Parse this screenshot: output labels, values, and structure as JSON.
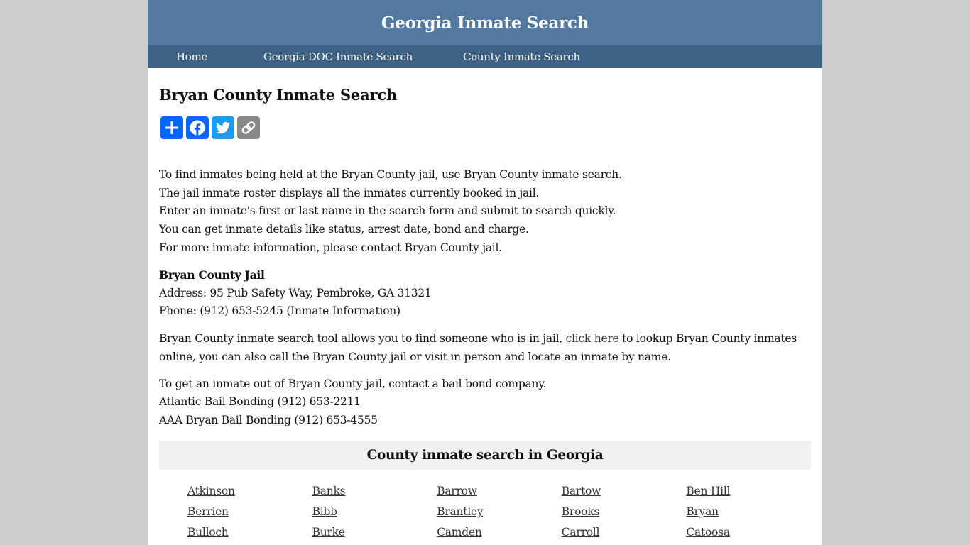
{
  "site": {
    "title": "Georgia Inmate Search"
  },
  "nav": {
    "items": [
      {
        "label": "Home"
      },
      {
        "label": "Georgia DOC Inmate Search"
      },
      {
        "label": "County Inmate Search"
      }
    ]
  },
  "page": {
    "title": "Bryan County Inmate Search"
  },
  "share": {
    "buttons": [
      {
        "icon": "share-plus-icon",
        "label": "Share",
        "color": "#0166ff"
      },
      {
        "icon": "facebook-icon",
        "label": "Facebook",
        "color": "#0866ff"
      },
      {
        "icon": "twitter-icon",
        "label": "Twitter",
        "color": "#1d9bf0"
      },
      {
        "icon": "copy-link-icon",
        "label": "Copy Link",
        "color": "#888888"
      }
    ]
  },
  "intro": {
    "lines": [
      "To find inmates being held at the Bryan County jail, use Bryan County inmate search.",
      "The jail inmate roster displays all the inmates currently booked in jail.",
      "Enter an inmate's first or last name in the search form and submit to search quickly.",
      "You can get inmate details like status, arrest date, bond and charge.",
      "For more inmate information, please contact Bryan County jail."
    ]
  },
  "jail": {
    "name": "Bryan County Jail",
    "address": "Address: 95 Pub Safety Way, Pembroke, GA 31321",
    "phone": "Phone: (912) 653-5245 (Inmate Information)"
  },
  "search_tool": {
    "before_link": "Bryan County inmate search tool allows you to find someone who is in jail, ",
    "link_text": "click here",
    "after_link": " to lookup Bryan County inmates online, you can also call the Bryan County jail or visit in person and locate an inmate by name."
  },
  "bail": {
    "intro": "To get an inmate out of Bryan County jail, contact a bail bond company.",
    "companies": [
      "Atlantic Bail Bonding (912) 653-2211",
      "AAA Bryan Bail Bonding (912) 653-4555"
    ]
  },
  "counties": {
    "heading": "County inmate search in Georgia",
    "items": [
      "Atkinson",
      "Banks",
      "Barrow",
      "Bartow",
      "Ben Hill",
      "Berrien",
      "Bibb",
      "Brantley",
      "Brooks",
      "Bryan",
      "Bulloch",
      "Burke",
      "Camden",
      "Carroll",
      "Catoosa"
    ]
  }
}
